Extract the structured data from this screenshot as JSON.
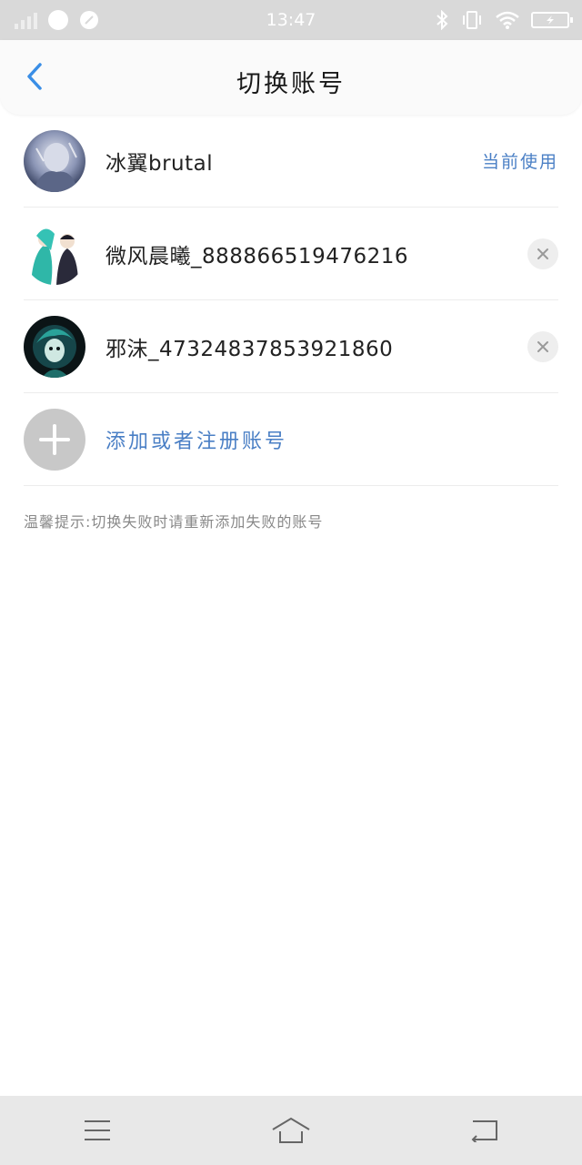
{
  "status_bar": {
    "time": "13:47"
  },
  "header": {
    "title": "切换账号"
  },
  "accounts": [
    {
      "name": "冰翼brutal",
      "status": "当前使用"
    },
    {
      "name": "微风晨曦_888866519476216"
    },
    {
      "name": "邪沫_47324837853921860"
    }
  ],
  "add_account": {
    "label": "添加或者注册账号"
  },
  "tip": "温馨提示:切换失败时请重新添加失败的账号",
  "colors": {
    "accent": "#4a7fc5",
    "back_arrow": "#3a8ee6",
    "status_bar_bg": "#d9d9d9",
    "nav_bar_bg": "#e8e8e8"
  },
  "icons": {
    "status_left": [
      "signal-icon",
      "chat-bubble-icon",
      "clock-icon"
    ],
    "status_right": [
      "bluetooth-icon",
      "vibrate-icon",
      "wifi-icon",
      "battery-charging-icon"
    ],
    "nav": [
      "menu-icon",
      "home-icon",
      "back-icon"
    ]
  }
}
